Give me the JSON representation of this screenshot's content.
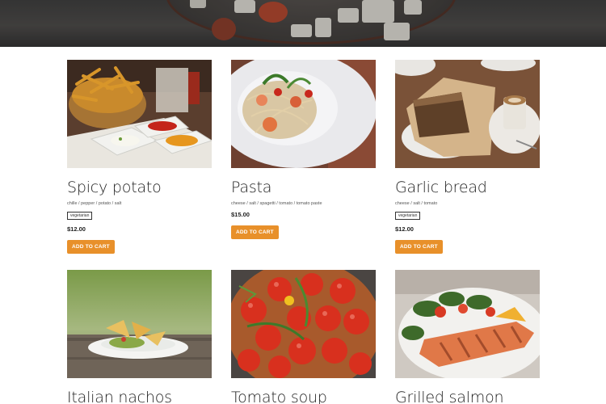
{
  "products": [
    {
      "title": "Spicy potato",
      "ingredients": "chille / pepper / potato / salt",
      "tag": "vegetarian",
      "price": "$12.00",
      "cart_label": "ADD TO CART",
      "image": "fries-basket-with-dips"
    },
    {
      "title": "Pasta",
      "ingredients": "cheese / salt / spagetti / tomato / tomato paste",
      "price": "$15.00",
      "cart_label": "ADD TO CART",
      "image": "shrimp-pasta-plate"
    },
    {
      "title": "Garlic bread",
      "ingredients": "cheese / salt / tomato",
      "tag": "vegetarian",
      "price": "$12.00",
      "cart_label": "ADD TO CART",
      "image": "garlic-bread-with-coffee"
    },
    {
      "title": "Italian nachos",
      "image": "nachos-plate-outdoor"
    },
    {
      "title": "Tomato soup",
      "image": "tomatoes-in-bowl"
    },
    {
      "title": "Grilled salmon",
      "image": "salmon-with-salad"
    }
  ],
  "colors": {
    "cart_button": "#e8902a",
    "title_text": "#1d1d1d"
  }
}
